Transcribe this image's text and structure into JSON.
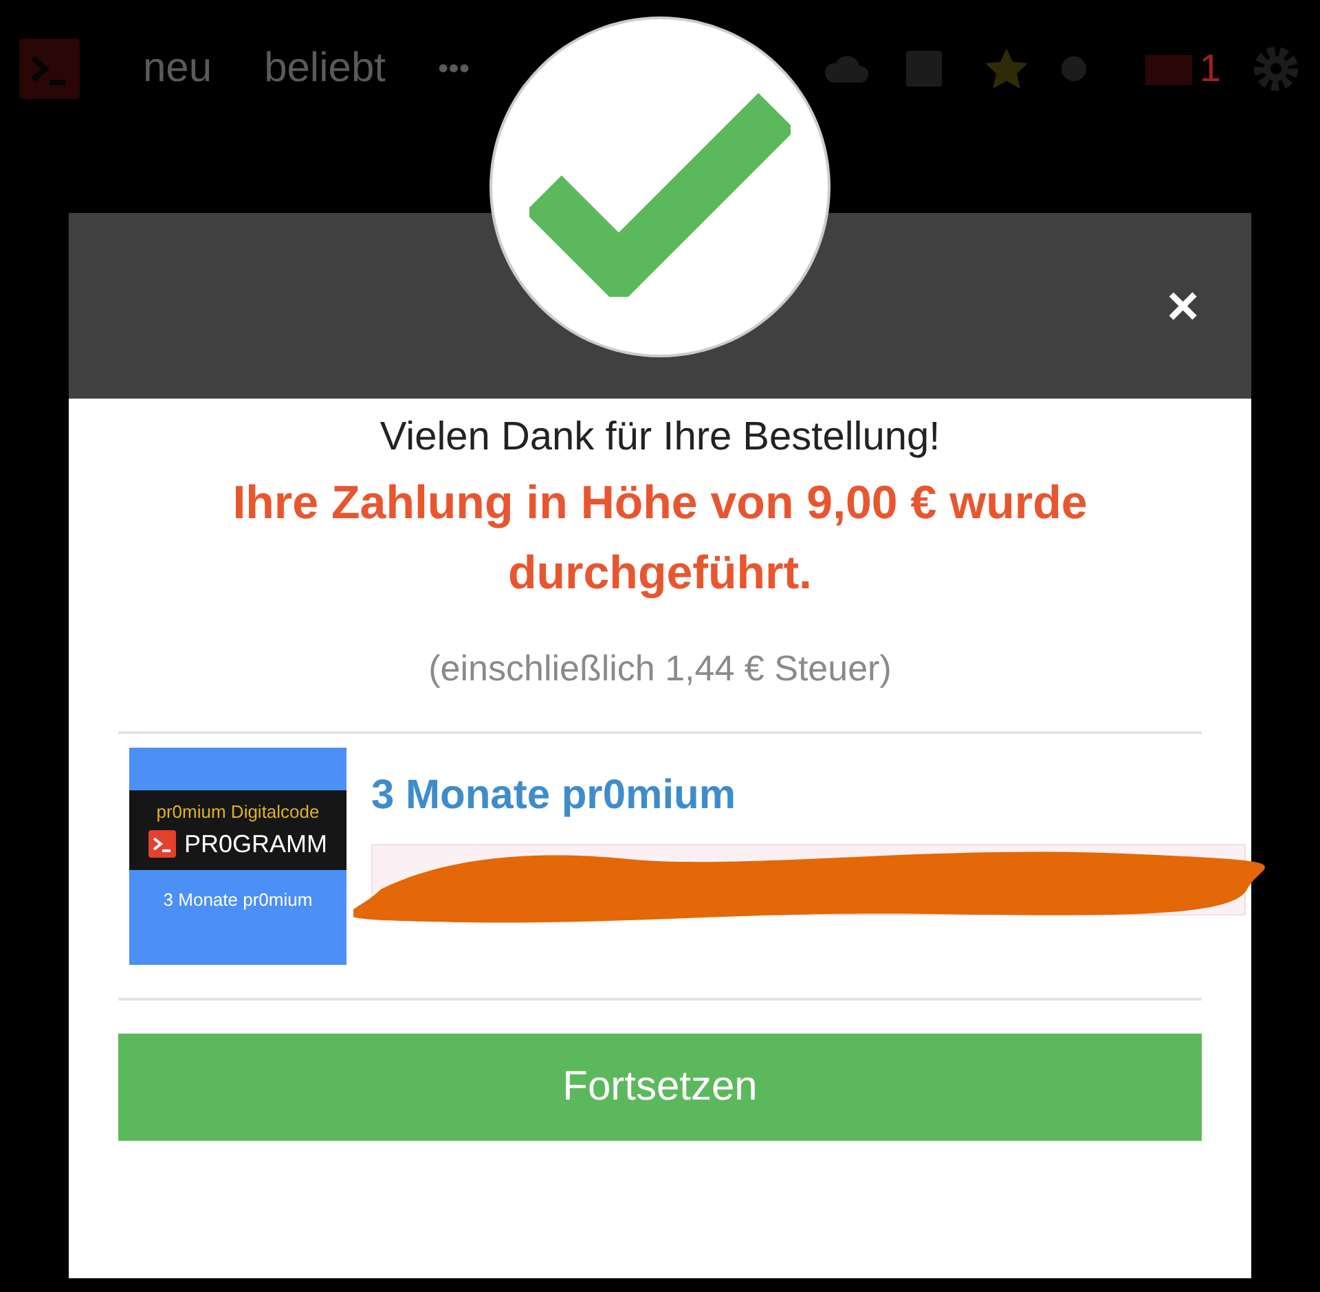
{
  "topbar": {
    "nav": [
      "neu",
      "beliebt",
      "•••"
    ],
    "mail_count": "1"
  },
  "dialog": {
    "close": "×",
    "thanks": "Vielen Dank für Ihre Bestellung!",
    "payment": "Ihre Zahlung in Höhe von 9,00 € wurde durchgeführt.",
    "tax": "(einschließlich 1,44 € Steuer)",
    "product": {
      "image": {
        "top": "pr0mium Digitalcode",
        "brand": "PR0GRAMM",
        "bottom": "3 Monate pr0mium"
      },
      "title": "3 Monate pr0mium"
    },
    "button": "Fortsetzen"
  }
}
